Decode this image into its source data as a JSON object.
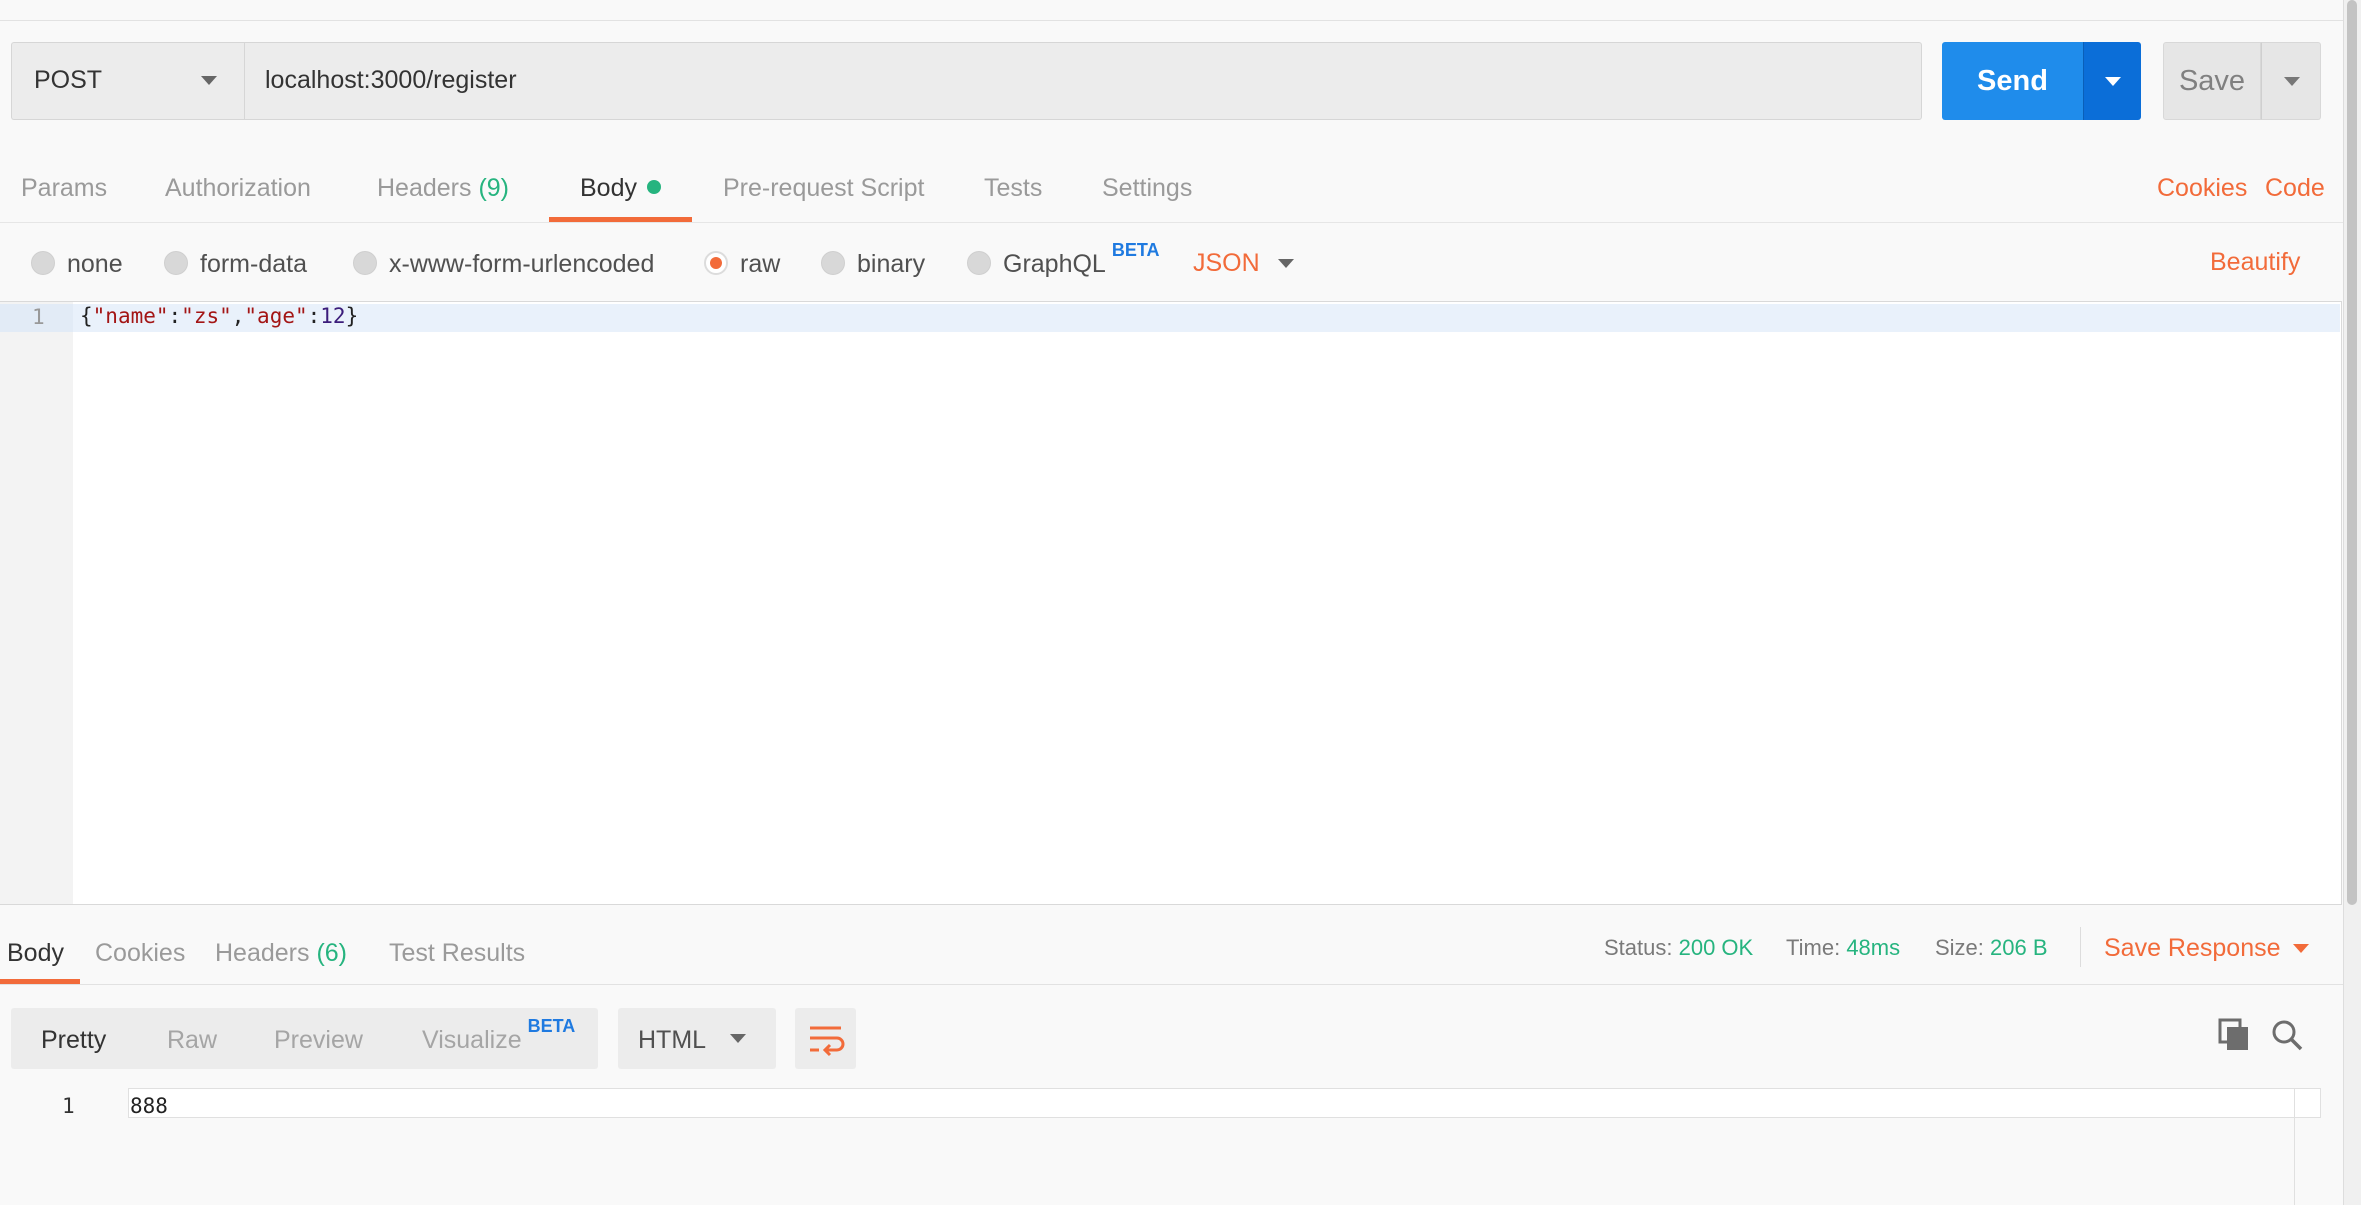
{
  "request": {
    "method": "POST",
    "url": "localhost:3000/register",
    "send_label": "Send",
    "save_label": "Save"
  },
  "request_tabs": [
    {
      "label": "Params"
    },
    {
      "label": "Authorization"
    },
    {
      "label": "Headers",
      "count": "(9)"
    },
    {
      "label": "Body",
      "active": true
    },
    {
      "label": "Pre-request Script"
    },
    {
      "label": "Tests"
    },
    {
      "label": "Settings"
    }
  ],
  "links": {
    "cookies": "Cookies",
    "code": "Code",
    "beautify": "Beautify"
  },
  "body_types": [
    {
      "label": "none"
    },
    {
      "label": "form-data"
    },
    {
      "label": "x-www-form-urlencoded"
    },
    {
      "label": "raw",
      "selected": true
    },
    {
      "label": "binary"
    },
    {
      "label": "GraphQL",
      "badge": "BETA"
    }
  ],
  "format": "JSON",
  "editor": {
    "line_number": "1",
    "tokens": [
      "{",
      "\"name\"",
      ":",
      "\"zs\"",
      ",",
      "\"age\"",
      ":",
      "12",
      "}"
    ]
  },
  "response": {
    "tabs": [
      {
        "label": "Body",
        "active": true
      },
      {
        "label": "Cookies"
      },
      {
        "label": "Headers",
        "count": "(6)"
      },
      {
        "label": "Test Results"
      }
    ],
    "status_label": "Status:",
    "status_value": "200 OK",
    "time_label": "Time:",
    "time_value": "48ms",
    "size_label": "Size:",
    "size_value": "206 B",
    "save_response": "Save Response",
    "view_modes": [
      {
        "label": "Pretty",
        "active": true
      },
      {
        "label": "Raw"
      },
      {
        "label": "Preview"
      },
      {
        "label": "Visualize",
        "badge": "BETA"
      }
    ],
    "language": "HTML",
    "line_number": "1",
    "content": "888"
  },
  "colors": {
    "accent": "#f26b3a",
    "send": "#1f8ceb",
    "success": "#26b47f"
  }
}
